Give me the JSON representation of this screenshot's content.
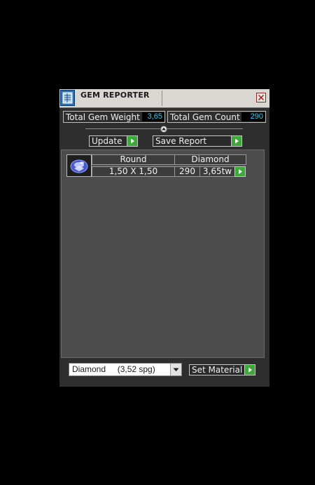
{
  "window": {
    "title": "GEM REPORTER"
  },
  "stats": {
    "total_weight_label": "Total Gem Weight",
    "total_weight_value": "3,65",
    "total_count_label": "Total Gem Count",
    "total_count_value": "290"
  },
  "toolbar": {
    "update_label": "Update",
    "save_report_label": "Save Report"
  },
  "gem_rows": [
    {
      "shape": "Round",
      "material": "Diamond",
      "size": "1,50 X 1,50",
      "count": "290",
      "weight": "3,65tw"
    }
  ],
  "material_select": {
    "selected": "Diamond     (3,52 spg)",
    "button_label": "Set Material"
  },
  "colors": {
    "accent_green": "#3fa83a",
    "value_cyan": "#49c7e6",
    "panel_bg": "#2e2e2e",
    "list_bg": "#4c4c4c"
  },
  "icons": {
    "app": "gem-reporter-app-icon",
    "close": "close-icon",
    "collapse": "collapse-up-icon",
    "go": "play-arrow-icon",
    "dropdown": "chevron-down-icon",
    "gem": "round-gem-icon"
  }
}
